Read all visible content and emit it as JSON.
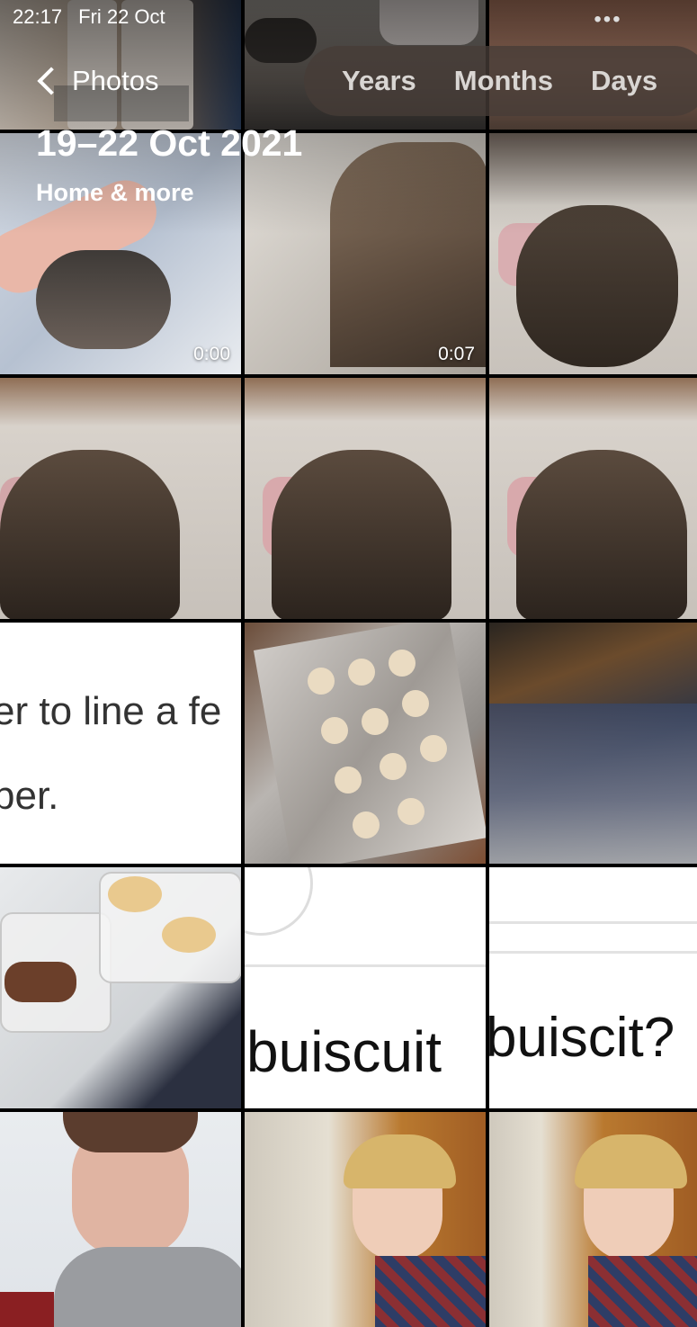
{
  "status_bar": {
    "time": "22:17",
    "date": "Fri 22 Oct"
  },
  "nav": {
    "back_label": "Photos",
    "more_icon": "ellipsis-icon"
  },
  "segments": [
    "Years",
    "Months",
    "Days"
  ],
  "header": {
    "title": "19–22 Oct 2021",
    "subtitle": "Home & more"
  },
  "tiles": [
    {
      "kind": "photo",
      "subject": "bottles-drink-the"
    },
    {
      "kind": "photo",
      "subject": "skateboard-cushion"
    },
    {
      "kind": "photo",
      "subject": "skin-closeup"
    },
    {
      "kind": "video",
      "subject": "cat-petted-on-blanket",
      "duration": "0:00"
    },
    {
      "kind": "video",
      "subject": "cat-stretching",
      "duration": "0:07"
    },
    {
      "kind": "photo",
      "subject": "cat-on-bed"
    },
    {
      "kind": "photo",
      "subject": "cat-on-bed"
    },
    {
      "kind": "photo",
      "subject": "cat-on-bed"
    },
    {
      "kind": "photo",
      "subject": "cat-on-bed"
    },
    {
      "kind": "screenshot",
      "lines": [
        "er to line a fe",
        "per."
      ]
    },
    {
      "kind": "photo",
      "subject": "biscuits-on-tray"
    },
    {
      "kind": "photo",
      "subject": "biscuits-in-oven"
    },
    {
      "kind": "photo",
      "subject": "biscuits-and-chocolate-tub"
    },
    {
      "kind": "screenshot",
      "lines": [
        "buiscuit"
      ]
    },
    {
      "kind": "screenshot",
      "lines": [
        "buiscit?"
      ]
    },
    {
      "kind": "photo",
      "subject": "person-smiling"
    },
    {
      "kind": "photo",
      "subject": "person-in-kitchen"
    },
    {
      "kind": "photo",
      "subject": "person-in-kitchen"
    }
  ],
  "colors": {
    "accent": "#ffffff",
    "segment_bg": "#463c37"
  }
}
